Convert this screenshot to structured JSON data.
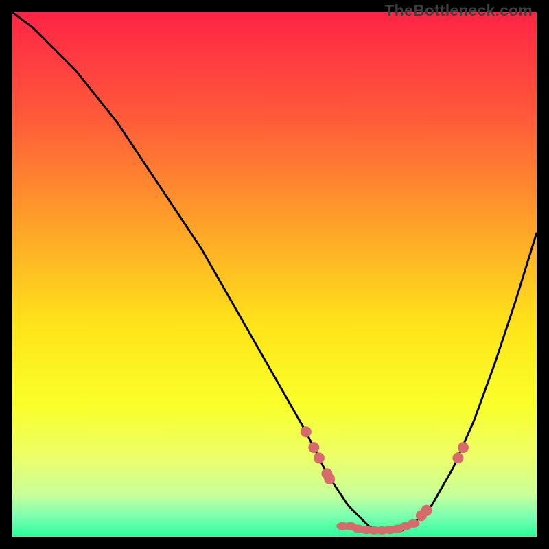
{
  "watermark": "TheBottleneck.com",
  "colors": {
    "gradient_stops": [
      {
        "offset": 0.0,
        "color": "#ff2445"
      },
      {
        "offset": 0.2,
        "color": "#ff5a3a"
      },
      {
        "offset": 0.4,
        "color": "#ffa029"
      },
      {
        "offset": 0.6,
        "color": "#ffe51a"
      },
      {
        "offset": 0.75,
        "color": "#f9ff2a"
      },
      {
        "offset": 0.85,
        "color": "#ecff6a"
      },
      {
        "offset": 0.92,
        "color": "#c8ff9a"
      },
      {
        "offset": 0.96,
        "color": "#7dffb0"
      },
      {
        "offset": 1.0,
        "color": "#2aff9a"
      }
    ],
    "dot": "#d66b6b",
    "curve": "#000000",
    "frame": "#000000"
  },
  "chart_data": {
    "type": "line",
    "title": "",
    "xlabel": "",
    "ylabel": "",
    "xlim": [
      0,
      100
    ],
    "ylim": [
      0,
      100
    ],
    "series": [
      {
        "name": "bottleneck-curve",
        "x": [
          0,
          4,
          8,
          12,
          16,
          20,
          24,
          28,
          32,
          36,
          40,
          44,
          48,
          52,
          56,
          58,
          60,
          62,
          64,
          66,
          68,
          70,
          72,
          74,
          76,
          80,
          84,
          88,
          92,
          96,
          100
        ],
        "y": [
          100,
          97,
          93,
          89,
          84,
          79,
          73,
          67,
          61,
          55,
          48,
          41,
          34,
          27,
          20,
          16,
          12,
          9,
          6,
          4,
          2,
          1,
          1,
          1,
          2,
          6,
          13,
          22,
          33,
          45,
          58
        ]
      }
    ],
    "markers_left_branch": [
      {
        "x": 56,
        "y": 20
      },
      {
        "x": 57.5,
        "y": 17
      },
      {
        "x": 58.5,
        "y": 15
      },
      {
        "x": 60,
        "y": 12
      },
      {
        "x": 60.5,
        "y": 11
      }
    ],
    "markers_right_branch": [
      {
        "x": 78,
        "y": 4
      },
      {
        "x": 79,
        "y": 5
      },
      {
        "x": 85,
        "y": 15
      },
      {
        "x": 86,
        "y": 17
      }
    ],
    "markers_valley_flat": [
      {
        "x": 63,
        "y": 2
      },
      {
        "x": 64.5,
        "y": 2
      },
      {
        "x": 66,
        "y": 1.5
      },
      {
        "x": 67.5,
        "y": 1.3
      },
      {
        "x": 69,
        "y": 1.2
      },
      {
        "x": 70.5,
        "y": 1.2
      },
      {
        "x": 72,
        "y": 1.3
      },
      {
        "x": 73.5,
        "y": 1.5
      },
      {
        "x": 75,
        "y": 2
      },
      {
        "x": 76.5,
        "y": 2.5
      }
    ]
  }
}
